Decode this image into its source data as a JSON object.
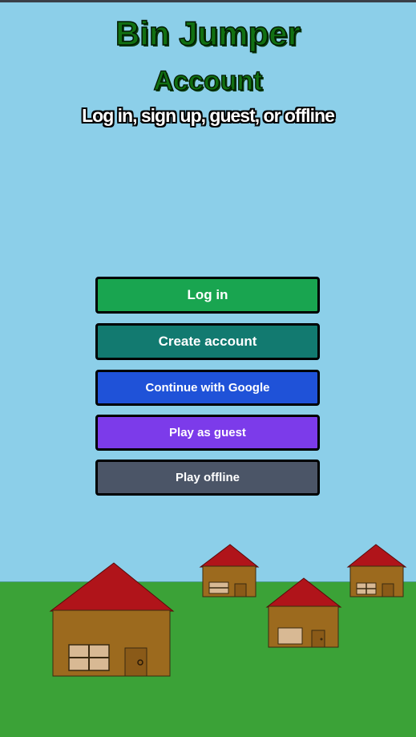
{
  "game": {
    "title": "Bin Jumper",
    "screen_title": "Account",
    "tagline": "Log in, sign up, guest, or offline"
  },
  "menu": {
    "login_label": "Log in",
    "create_account_label": "Create account",
    "google_label": "Continue with Google",
    "guest_label": "Play as guest",
    "offline_label": "Play offline"
  },
  "colors": {
    "sky": "#8ccfe9",
    "grass": "#3ba237",
    "title_green": "#127012",
    "login": "#19a550",
    "create_account": "#127a70",
    "google": "#1f52d8",
    "guest": "#7c3bea",
    "offline": "#4b5567",
    "house_wall": "#9c6a1e",
    "house_roof": "#b0141a",
    "house_window": "#d8b994"
  },
  "scenery": {
    "houses": [
      "house-large",
      "house-small-left",
      "house-center",
      "house-right"
    ]
  }
}
